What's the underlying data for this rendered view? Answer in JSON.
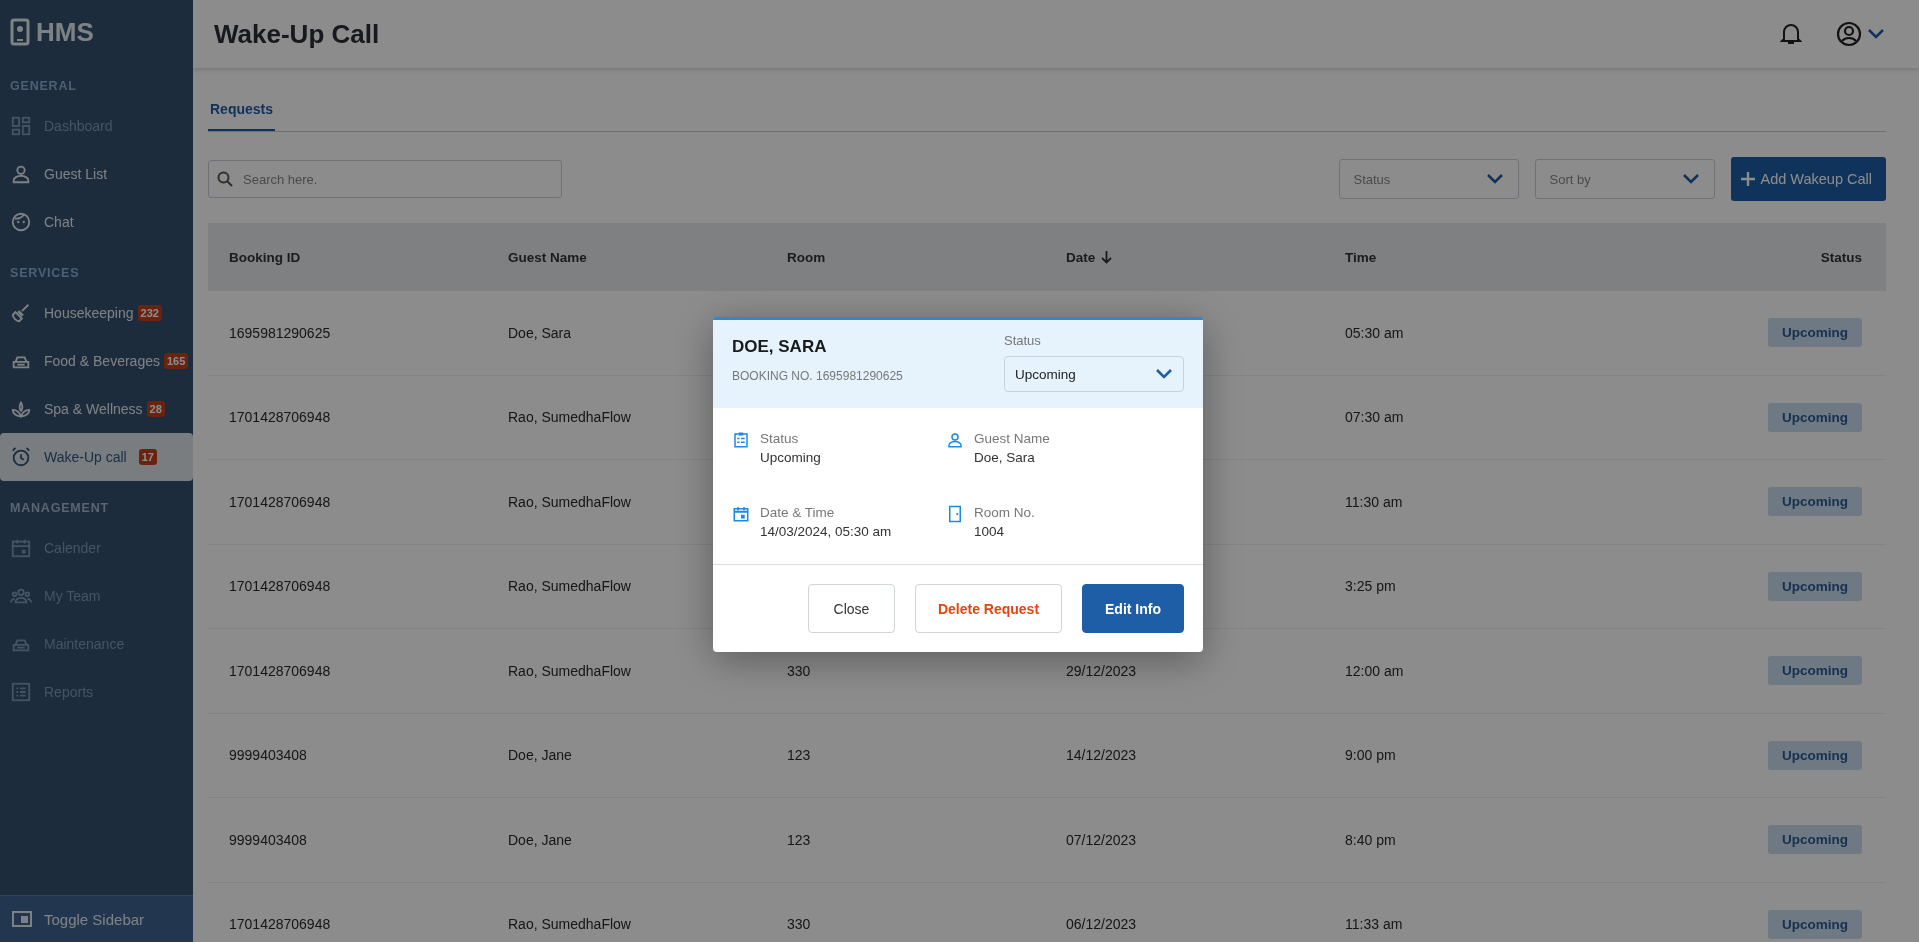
{
  "sidebar": {
    "logo": "HMS",
    "sections": [
      {
        "title": "GENERAL",
        "items": [
          {
            "kind": "dashboard",
            "label": "Dashboard",
            "disabled": true,
            "selected": false
          },
          {
            "kind": "guests",
            "label": "Guest List",
            "disabled": false,
            "selected": false
          },
          {
            "kind": "chat",
            "label": "Chat",
            "disabled": false,
            "selected": false
          }
        ]
      },
      {
        "title": "SERVICES",
        "items": [
          {
            "kind": "housekeeping",
            "label": "Housekeeping",
            "badge": "232",
            "disabled": false,
            "selected": false
          },
          {
            "kind": "food",
            "label": "Food & Beverages",
            "badge": "165",
            "disabled": false,
            "selected": false
          },
          {
            "kind": "spa",
            "label": "Spa & Wellness",
            "badge": "28",
            "disabled": false,
            "selected": false
          },
          {
            "kind": "alarm",
            "label": "Wake-Up call",
            "badge": "17",
            "disabled": false,
            "selected": true
          }
        ]
      },
      {
        "title": "MANAGEMENT",
        "items": [
          {
            "kind": "calendar",
            "label": "Calender",
            "disabled": true,
            "selected": false
          },
          {
            "kind": "team",
            "label": "My Team",
            "disabled": true,
            "selected": false
          },
          {
            "kind": "food",
            "label": "Maintenance",
            "disabled": true,
            "selected": false
          },
          {
            "kind": "reports",
            "label": "Reports",
            "disabled": true,
            "selected": false
          }
        ]
      }
    ],
    "toggle": "Toggle Sidebar"
  },
  "header": {
    "title": "Wake-Up Call"
  },
  "tabs": [
    {
      "label": "Requests",
      "selected": true
    }
  ],
  "toolbar": {
    "search": {
      "placeholder": "Search here."
    },
    "filters": [
      {
        "placeholder": "Status"
      },
      {
        "placeholder": "Sort by"
      }
    ],
    "add_button": "Add Wakeup Call"
  },
  "table": {
    "columns": [
      {
        "label": "Booking ID",
        "sorted": false
      },
      {
        "label": "Guest Name",
        "sorted": false
      },
      {
        "label": "Room",
        "sorted": false
      },
      {
        "label": "Date",
        "sorted": true
      },
      {
        "label": "Time",
        "sorted": false
      },
      {
        "label": "Status",
        "sorted": false
      }
    ],
    "rows": [
      {
        "booking_id": "1695981290625",
        "guest_name": "Doe, Sara",
        "time": "05:30 am",
        "status": "Upcoming"
      },
      {
        "booking_id": "1701428706948",
        "guest_name": "Rao, SumedhaFlow",
        "time": "07:30 am",
        "status": "Upcoming"
      },
      {
        "booking_id": "1701428706948",
        "guest_name": "Rao, SumedhaFlow",
        "time": "11:30 am",
        "status": "Upcoming"
      },
      {
        "booking_id": "1701428706948",
        "guest_name": "Rao, SumedhaFlow",
        "time": "3:25 pm",
        "status": "Upcoming"
      },
      {
        "booking_id": "1701428706948",
        "guest_name": "Rao, SumedhaFlow",
        "room": "330",
        "date": "29/12/2023",
        "time": "12:00 am",
        "status": "Upcoming"
      },
      {
        "booking_id": "9999403408",
        "guest_name": "Doe, Jane",
        "room": "123",
        "date": "14/12/2023",
        "time": "9:00 pm",
        "status": "Upcoming"
      },
      {
        "booking_id": "9999403408",
        "guest_name": "Doe, Jane",
        "room": "123",
        "date": "07/12/2023",
        "time": "8:40 pm",
        "status": "Upcoming"
      },
      {
        "booking_id": "1701428706948",
        "guest_name": "Rao, SumedhaFlow",
        "room": "330",
        "date": "06/12/2023",
        "time": "11:33 am",
        "status": "Upcoming"
      }
    ]
  },
  "modal": {
    "title": "DOE, SARA",
    "booking": "BOOKING NO. 1695981290625",
    "status_label": "Status",
    "status_value": "Upcoming",
    "details": [
      {
        "kind": "status",
        "label": "Status",
        "value": "Upcoming"
      },
      {
        "kind": "guest",
        "label": "Guest Name",
        "value": "Doe, Sara"
      },
      {
        "kind": "datetime",
        "label": "Date & Time",
        "value": "14/03/2024, 05:30 am"
      },
      {
        "kind": "room",
        "label": "Room No.",
        "value": "1004"
      }
    ],
    "buttons": [
      {
        "kind": "secondary",
        "label": "Close"
      },
      {
        "kind": "danger",
        "label": "Delete Request"
      },
      {
        "kind": "primary",
        "label": "Edit Info"
      }
    ]
  }
}
